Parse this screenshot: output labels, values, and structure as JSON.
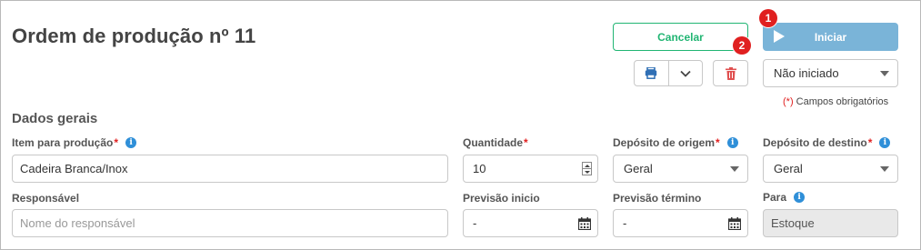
{
  "header": {
    "title": "Ordem de produção nº 11",
    "cancel_label": "Cancelar",
    "start_label": "Iniciar",
    "badge_1": "1",
    "badge_2": "2",
    "status_value": "Não iniciado",
    "required_note_star": "(*)",
    "required_note_text": " Campos obrigatórios"
  },
  "section_title": "Dados gerais",
  "fields": {
    "item": {
      "label": "Item para produção",
      "required": "*",
      "value": "Cadeira Branca/Inox"
    },
    "quantity": {
      "label": "Quantidade",
      "required": "*",
      "value": "10"
    },
    "origin": {
      "label": "Depósito de origem",
      "required": "*",
      "value": "Geral"
    },
    "destination": {
      "label": "Depósito de destino",
      "required": "*",
      "value": "Geral"
    },
    "responsible": {
      "label": "Responsável",
      "placeholder": "Nome do responsável"
    },
    "start_forecast": {
      "label": "Previsão inicio",
      "value": "-"
    },
    "end_forecast": {
      "label": "Previsão término",
      "value": "-"
    },
    "for": {
      "label": "Para",
      "value": "Estoque"
    }
  },
  "icons": {
    "info": "i",
    "print": "printer-icon",
    "dropdown": "chevron-down-icon",
    "trash": "trash-icon",
    "play": "play-icon",
    "calendar": "calendar-icon"
  },
  "colors": {
    "accent_green": "#21b573",
    "start_blue": "#7ab4d8",
    "info_blue": "#2f8fd8",
    "danger_red": "#e02020"
  }
}
